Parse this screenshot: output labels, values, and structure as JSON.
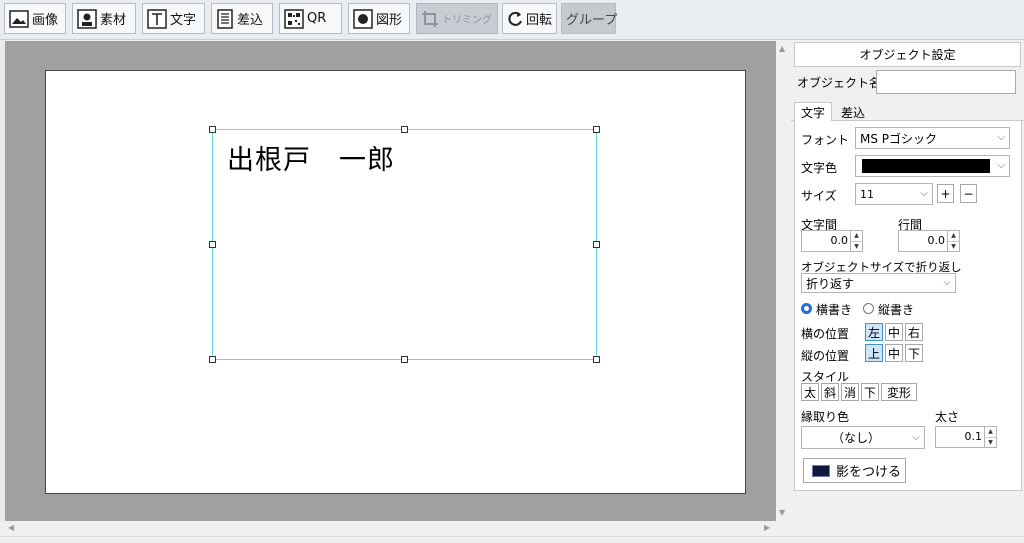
{
  "toolbar": {
    "image": "画像",
    "material": "素材",
    "text": "文字",
    "merge": "差込",
    "qr": "QR",
    "shape": "図形",
    "trimming": "トリミング",
    "rotate": "回転",
    "group": "グループ"
  },
  "canvas": {
    "text_object": "出根戸　一郎"
  },
  "panel": {
    "title": "オブジェクト設定",
    "object_name_label": "オブジェクト名",
    "object_name_value": "",
    "tabs": [
      "文字",
      "差込"
    ],
    "font_label": "フォント",
    "font_value": "MS Pゴシック",
    "text_color_label": "文字色",
    "text_color": "#000000",
    "size_label": "サイズ",
    "size_value": "11",
    "size_plus": "+",
    "size_minus": "−",
    "char_spacing_label": "文字間",
    "char_spacing_value": "0.0",
    "line_spacing_label": "行間",
    "line_spacing_value": "0.0",
    "wrap_label": "オブジェクトサイズで折り返し",
    "wrap_value": "折り返す",
    "horizontal_writing": "横書き",
    "vertical_writing": "縦書き",
    "h_position_label": "横の位置",
    "h_positions": [
      "左",
      "中",
      "右"
    ],
    "v_position_label": "縦の位置",
    "v_positions": [
      "上",
      "中",
      "下"
    ],
    "style_label": "スタイル",
    "styles": [
      "太",
      "斜",
      "消",
      "下",
      "変形"
    ],
    "outline_color_label": "縁取り色",
    "outline_color_value": "（なし）",
    "thickness_label": "太さ",
    "thickness_value": "0.1",
    "shadow_button": "影をつける"
  }
}
